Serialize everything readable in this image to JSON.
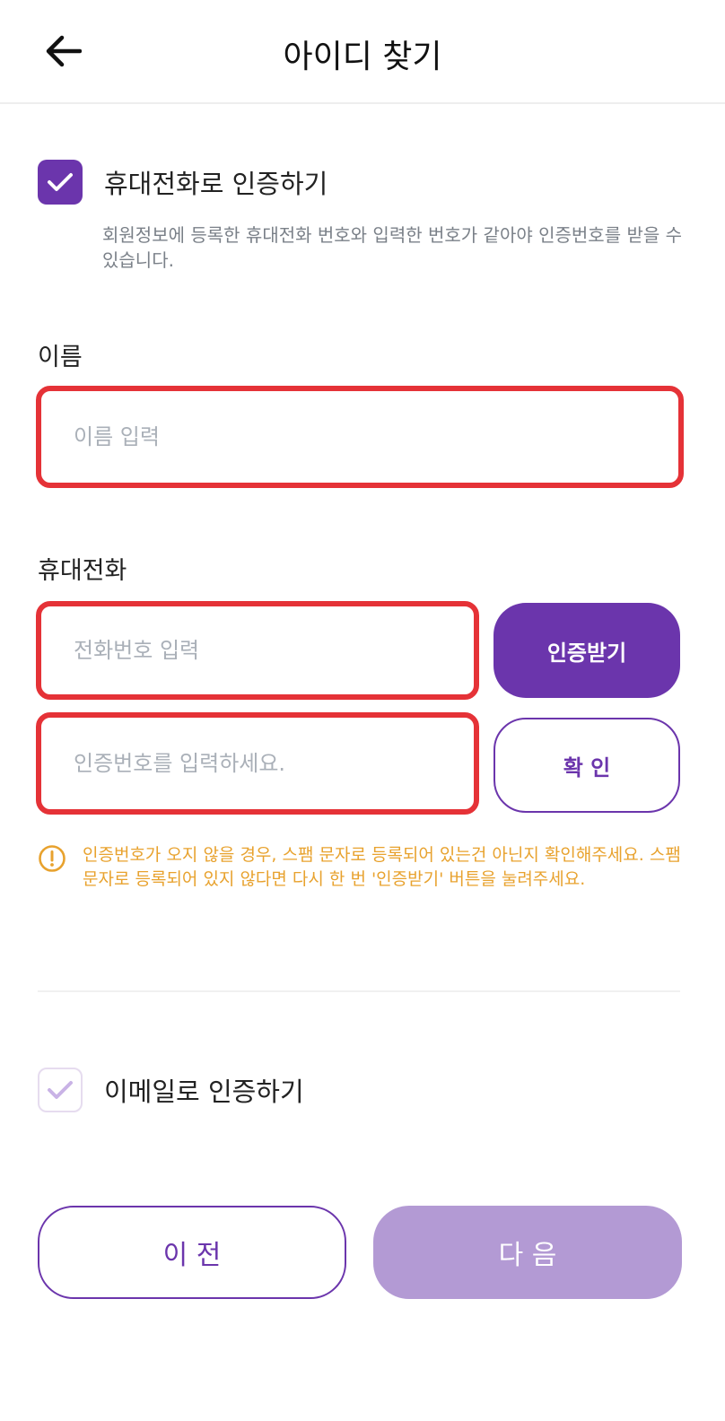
{
  "header": {
    "title": "아이디 찾기",
    "back_icon": "arrow-left-icon"
  },
  "phone_auth": {
    "label": "휴대전화로 인증하기",
    "checked": true,
    "description": "회원정보에 등록한 휴대전화 번호와 입력한 번호가 같아야 인증번호를 받을 수 있습니다."
  },
  "name_field": {
    "label": "이름",
    "placeholder": "이름 입력",
    "value": ""
  },
  "phone_field": {
    "label": "휴대전화",
    "phone_placeholder": "전화번호 입력",
    "code_placeholder": "인증번호를 입력하세요.",
    "request_button": "인증받기",
    "confirm_button": "확 인"
  },
  "notice": {
    "icon": "exclamation-circle-icon",
    "text": "인증번호가 오지 않을 경우, 스팸 문자로 등록되어 있는건 아닌지 확인해주세요. 스팸문자로 등록되어 있지 않다면 다시 한 번 '인증받기' 버튼을 눌려주세요."
  },
  "email_auth": {
    "label": "이메일로 인증하기",
    "checked": false
  },
  "footer": {
    "prev_button": "이 전",
    "next_button": "다 음"
  },
  "colors": {
    "brand": "#6b35ac",
    "brand_light": "#b39ad4",
    "highlight": "#e53237",
    "warning": "#e8a22e"
  }
}
